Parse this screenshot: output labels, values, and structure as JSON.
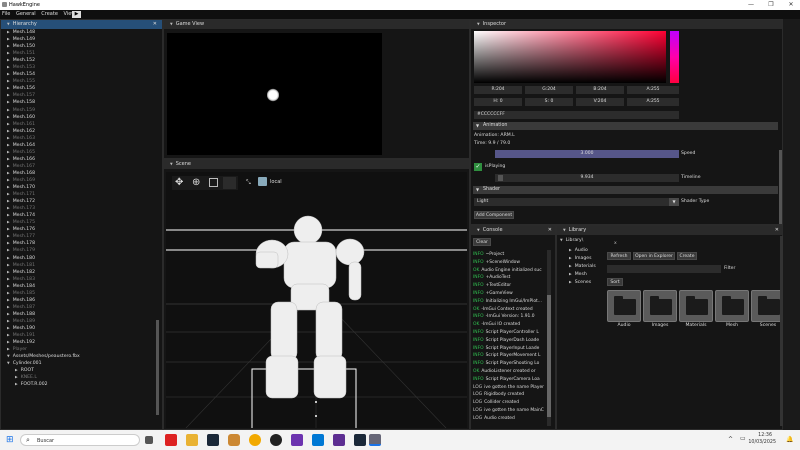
{
  "window": {
    "title": "HawkEngine",
    "controls": [
      "—",
      "❐",
      "✕"
    ]
  },
  "menu": [
    "File",
    "General",
    "Create",
    "View"
  ],
  "hierarchy": {
    "tab": "Hierarchy",
    "items": [
      {
        "label": "Mesh.148",
        "dim": false
      },
      {
        "label": "Mesh.149",
        "dim": false
      },
      {
        "label": "Mesh.150",
        "dim": false
      },
      {
        "label": "Mesh.151",
        "dim": true
      },
      {
        "label": "Mesh.152",
        "dim": false
      },
      {
        "label": "Mesh.153",
        "dim": true
      },
      {
        "label": "Mesh.154",
        "dim": false
      },
      {
        "label": "Mesh.155",
        "dim": true
      },
      {
        "label": "Mesh.156",
        "dim": false
      },
      {
        "label": "Mesh.157",
        "dim": true
      },
      {
        "label": "Mesh.158",
        "dim": false
      },
      {
        "label": "Mesh.159",
        "dim": true
      },
      {
        "label": "Mesh.160",
        "dim": false
      },
      {
        "label": "Mesh.161",
        "dim": true
      },
      {
        "label": "Mesh.162",
        "dim": false
      },
      {
        "label": "Mesh.163",
        "dim": true
      },
      {
        "label": "Mesh.164",
        "dim": false
      },
      {
        "label": "Mesh.165",
        "dim": true
      },
      {
        "label": "Mesh.166",
        "dim": false
      },
      {
        "label": "Mesh.167",
        "dim": true
      },
      {
        "label": "Mesh.168",
        "dim": false
      },
      {
        "label": "Mesh.169",
        "dim": true
      },
      {
        "label": "Mesh.170",
        "dim": false
      },
      {
        "label": "Mesh.171",
        "dim": true
      },
      {
        "label": "Mesh.172",
        "dim": false
      },
      {
        "label": "Mesh.173",
        "dim": true
      },
      {
        "label": "Mesh.174",
        "dim": false
      },
      {
        "label": "Mesh.175",
        "dim": true
      },
      {
        "label": "Mesh.176",
        "dim": false
      },
      {
        "label": "Mesh.177",
        "dim": true
      },
      {
        "label": "Mesh.178",
        "dim": false
      },
      {
        "label": "Mesh.179",
        "dim": true
      },
      {
        "label": "Mesh.180",
        "dim": false
      },
      {
        "label": "Mesh.181",
        "dim": true
      },
      {
        "label": "Mesh.182",
        "dim": false
      },
      {
        "label": "Mesh.183",
        "dim": true
      },
      {
        "label": "Mesh.184",
        "dim": false
      },
      {
        "label": "Mesh.185",
        "dim": true
      },
      {
        "label": "Mesh.186",
        "dim": false
      },
      {
        "label": "Mesh.187",
        "dim": true
      },
      {
        "label": "Mesh.188",
        "dim": false
      },
      {
        "label": "Mesh.189",
        "dim": true
      },
      {
        "label": "Mesh.190",
        "dim": false
      },
      {
        "label": "Mesh.191",
        "dim": true
      },
      {
        "label": "Mesh.192",
        "dim": false
      },
      {
        "label": "Player",
        "dim": true
      },
      {
        "label": "Assets/Meshes/peaustero.fbx",
        "dim": false
      },
      {
        "label": "Cylinder.001",
        "dim": false
      },
      {
        "label": "ROOT",
        "dim": false
      },
      {
        "label": "KNEE.L",
        "dim": true
      },
      {
        "label": "FOOT.R.002",
        "dim": false
      }
    ]
  },
  "game_view": {
    "tab": "Game View"
  },
  "scene": {
    "tab": "Scene",
    "toolbar_label": "local"
  },
  "inspector": {
    "tab": "Inspector",
    "rgba": {
      "r": "R:204",
      "g": "G:204",
      "b": "B:204",
      "a": "A:255"
    },
    "hsva": {
      "h": "H: 0",
      "s": "S: 0",
      "v": "V:204",
      "a": "A:255"
    },
    "hex": "#CCCCCCFF",
    "animation_header": "Animation",
    "animation_name": "Animation: ARM.L",
    "time": "Time: 9.9 / 79.0",
    "speed_value": "3.000",
    "speed_label": "Speed",
    "isplaying_label": "isPlaying",
    "timeline_value": "9.934",
    "timeline_label": "Timeline",
    "shader_header": "Shader",
    "shader_value": "Light",
    "shader_type_label": "Shader Type",
    "add_component": "Add Component"
  },
  "console": {
    "tab": "Console",
    "clear": "Clear",
    "rows": [
      {
        "tag": "INFO",
        "text": "~Project"
      },
      {
        "tag": "INFO",
        "text": "+SceneWindow"
      },
      {
        "tag": "OK",
        "text": "Audio Engine initialized suc"
      },
      {
        "tag": "INFO",
        "text": "+AudioTest"
      },
      {
        "tag": "INFO",
        "text": "+TextEditor"
      },
      {
        "tag": "INFO",
        "text": "+GameView"
      },
      {
        "tag": "INFO",
        "text": "Initializing ImGui/ImPlot..."
      },
      {
        "tag": "OK",
        "text": "-ImGui Context created"
      },
      {
        "tag": "INFO",
        "text": "-ImGui Version: 1.91.0"
      },
      {
        "tag": "OK",
        "text": "-ImGui IO created"
      },
      {
        "tag": "INFO",
        "text": "Script PlayerController L"
      },
      {
        "tag": "INFO",
        "text": "Script PlayerDash Loade"
      },
      {
        "tag": "INFO",
        "text": "Script PlayerInput Loade"
      },
      {
        "tag": "INFO",
        "text": "Script PlayerMovement L"
      },
      {
        "tag": "INFO",
        "text": "Script PlayerShooting Lo"
      },
      {
        "tag": "OK",
        "text": "AudioListener created or"
      },
      {
        "tag": "INFO",
        "text": "Script PlayerCamera Loa"
      },
      {
        "tag": "LOG",
        "text": "ive gotten the name Player"
      },
      {
        "tag": "LOG",
        "text": "Rigidbody created"
      },
      {
        "tag": "LOG",
        "text": "Collider created"
      },
      {
        "tag": "LOG",
        "text": "ive gotten the name MainC"
      },
      {
        "tag": "LOG",
        "text": "Audio created"
      }
    ]
  },
  "library": {
    "tab": "Library",
    "tree_root": "Library\\",
    "tree": [
      "Audio",
      "Images",
      "Materials",
      "Mesh",
      "Scenes"
    ],
    "close": "x",
    "refresh": "Refresh",
    "open_explorer": "Open in Explorer",
    "create": "Create",
    "filter_label": "Filter",
    "sort": "Sort",
    "folders": [
      "Audio",
      "Images",
      "Materials",
      "Mesh",
      "Scenes"
    ]
  },
  "taskbar": {
    "search": "Buscar",
    "time": "12:36",
    "date": "10/03/2025"
  },
  "colors": {
    "accent": "#264f78",
    "slider": "#565689",
    "checkbox": "#2f8f3f",
    "hue_top": "#c000ff",
    "hue_bottom": "#ff0040"
  }
}
